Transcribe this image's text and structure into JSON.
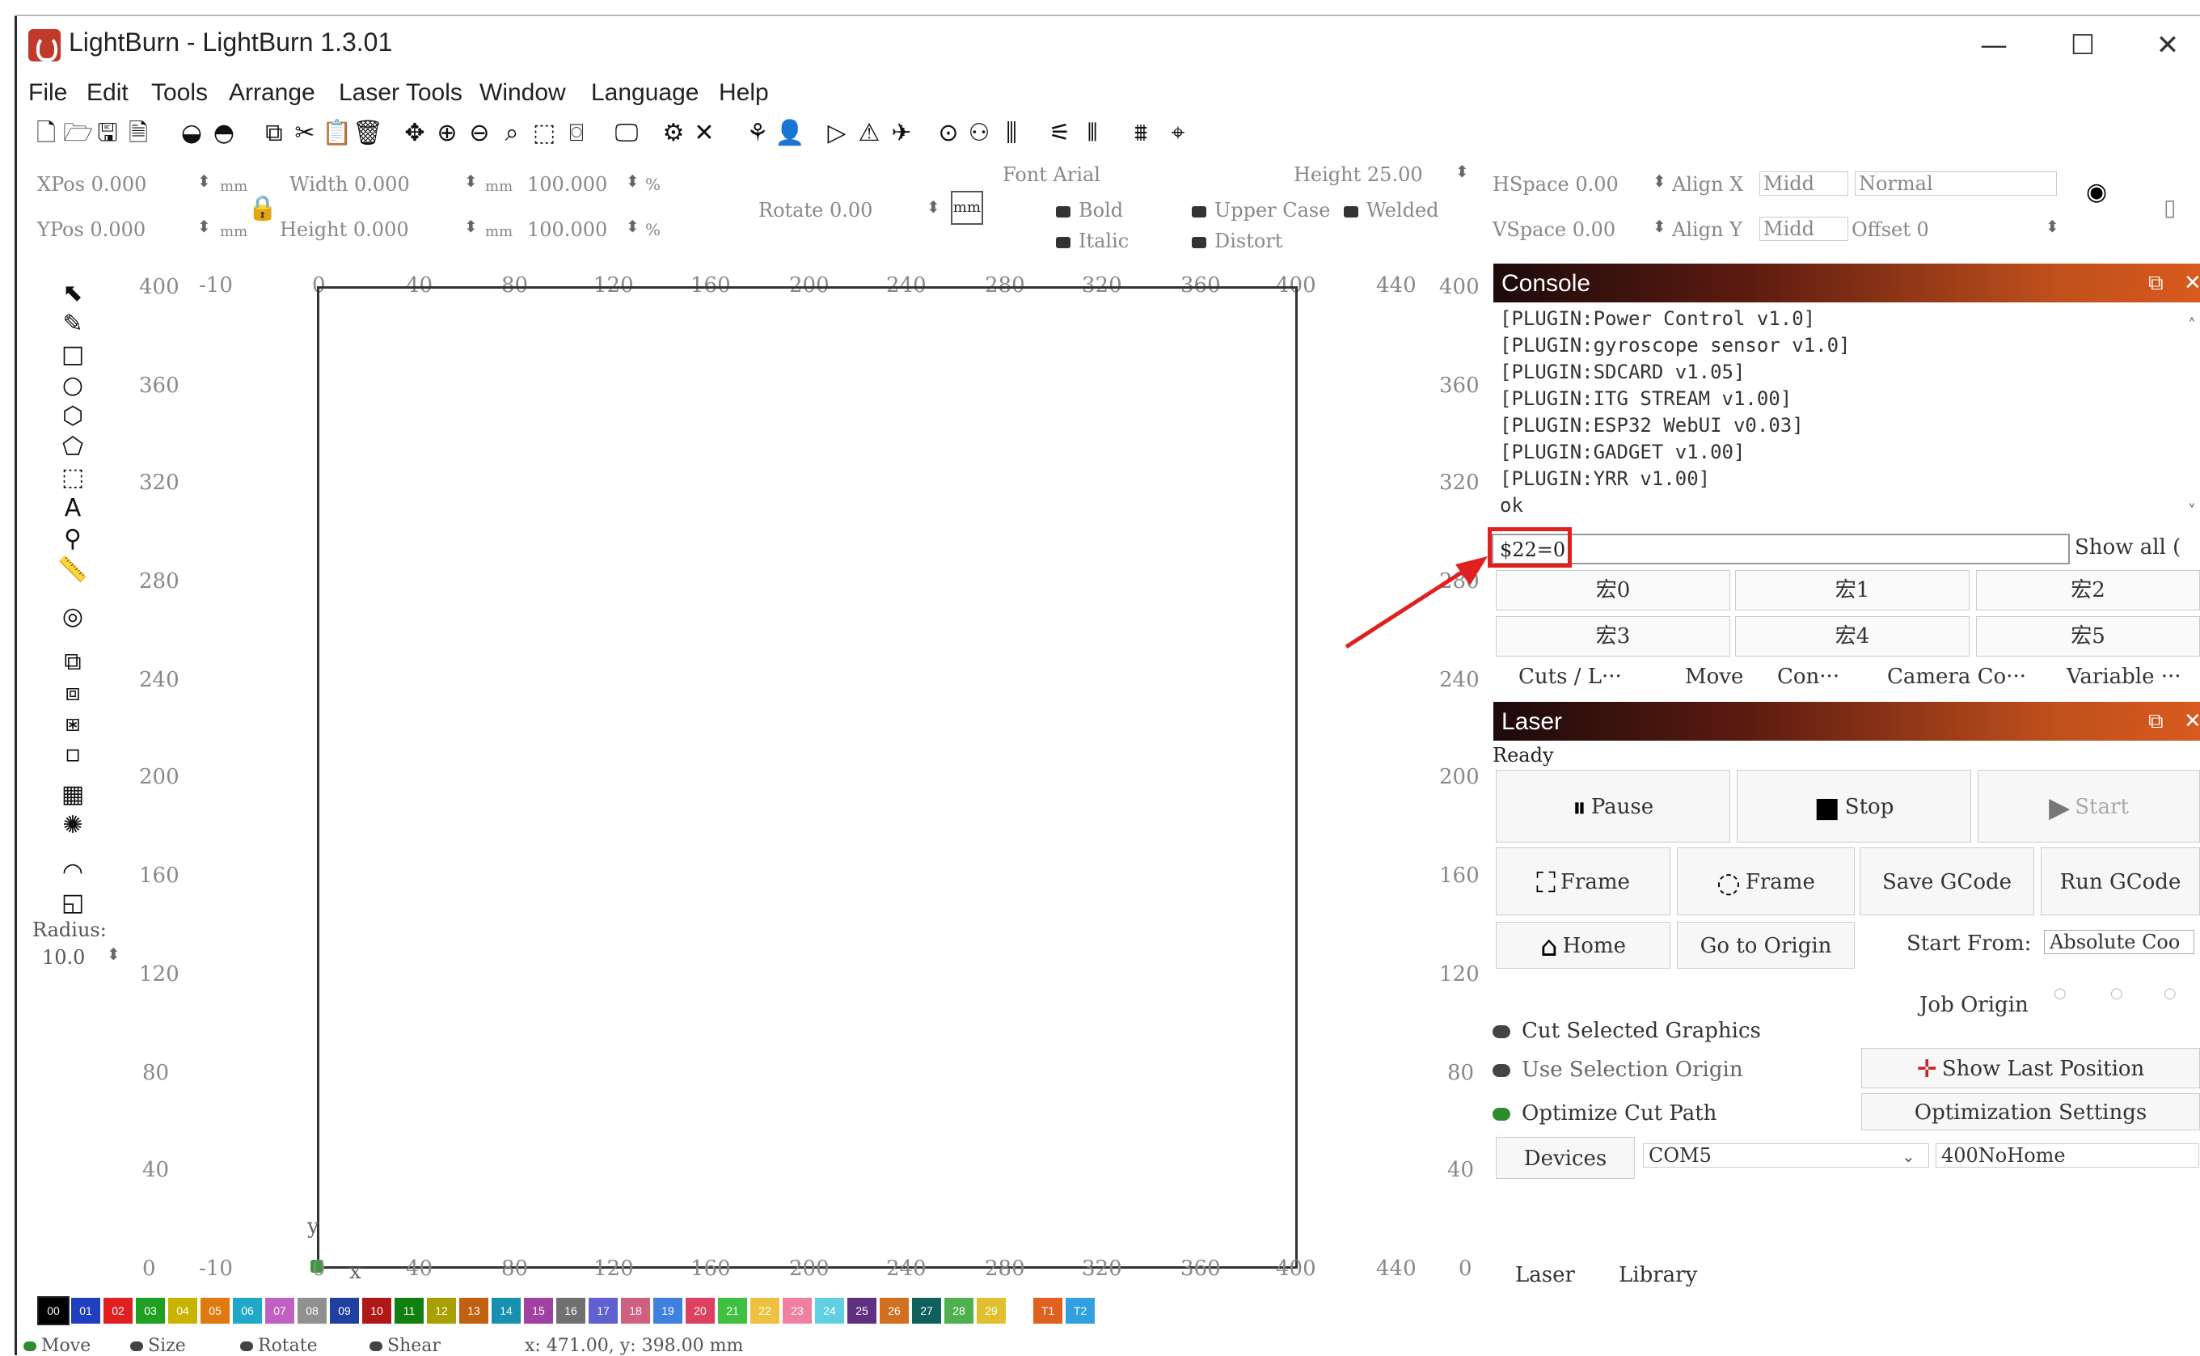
{
  "window": {
    "title": "LightBurn - LightBurn 1.3.01",
    "minimize": "—",
    "maximize": "☐",
    "close": "✕"
  },
  "menu": {
    "items": [
      "File",
      "Edit",
      "Tools",
      "Arrange",
      "Laser Tools",
      "Window",
      "Language",
      "Help"
    ]
  },
  "toolbar": {
    "icons": [
      "new-file-icon",
      "open-folder-icon",
      "save-icon",
      "save-as-icon",
      "import-icon",
      "export-icon",
      "copy-icon",
      "cut-icon",
      "paste-icon",
      "delete-icon",
      "move-icon",
      "zoom-in-icon",
      "zoom-out-icon",
      "zoom-fit-icon",
      "zoom-frame-icon",
      "camera-icon",
      "monitor-icon",
      "settings-icon",
      "tools-icon",
      "trace-icon",
      "user-icon",
      "send-icon",
      "arrange-icon",
      "dock-icon",
      "target-icon",
      "group-icon",
      "align-icon",
      "distribute-icon",
      "spacing-icon",
      "layout-icon",
      "center-icon"
    ]
  },
  "props": {
    "xpos": "XPos 0.000",
    "ypos": "YPos 0.000",
    "unit": "mm",
    "width": "Width 0.000",
    "height": "Height 0.000",
    "scale_w": "100.000",
    "scale_h": "100.000",
    "pct": "%",
    "rotate": "Rotate 0.00",
    "mm_toggle": "mm",
    "font": "Font Arial",
    "bold": "Bold",
    "italic": "Italic",
    "upper_case": "Upper Case",
    "distort": "Distort",
    "welded": "Welded",
    "font_height": "Height 25.00",
    "hspace": "HSpace 0.00",
    "vspace": "VSpace 0.00",
    "align_x": "Align X",
    "align_y": "Align Y",
    "align_x_val": "Midd",
    "align_y_val": "Midd",
    "normal": "Normal",
    "offset": "Offset 0"
  },
  "tools": {
    "radius_label": "Radius:",
    "radius_value": "10.0"
  },
  "rulers": {
    "top": [
      "-10",
      "0",
      "40",
      "80",
      "120",
      "160",
      "200",
      "240",
      "280",
      "320",
      "360",
      "400",
      "440"
    ],
    "bottom": [
      "-10",
      "0",
      "40",
      "80",
      "120",
      "160",
      "200",
      "240",
      "280",
      "320",
      "360",
      "400",
      "440"
    ],
    "left": [
      "400",
      "360",
      "320",
      "280",
      "240",
      "200",
      "160",
      "120",
      "80",
      "40",
      "0"
    ],
    "right": [
      "400",
      "360",
      "320",
      "280",
      "240",
      "200",
      "160",
      "120",
      "80",
      "40",
      "0"
    ],
    "axis_x": "x",
    "axis_y": "y"
  },
  "console": {
    "title": "Console",
    "lines": [
      "[PLUGIN:Power Control v1.0]",
      "[PLUGIN:gyroscope sensor v1.0]",
      "[PLUGIN:SDCARD v1.05]",
      "[PLUGIN:ITG STREAM v1.00]",
      "[PLUGIN:ESP32 WebUI v0.03]",
      "[PLUGIN:GADGET v1.00]",
      "[PLUGIN:YRR v1.00]",
      "ok"
    ],
    "input_value": "$22=0",
    "show_all": "Show all (",
    "macros": [
      "宏0",
      "宏1",
      "宏2",
      "宏3",
      "宏4",
      "宏5"
    ],
    "tabs": [
      "Cuts / L···",
      "Move",
      "Con···",
      "Camera Co···",
      "Variable ···"
    ]
  },
  "laser": {
    "title": "Laser",
    "status": "Ready",
    "pause": "Pause",
    "stop": "Stop",
    "start": "Start",
    "frame1": "Frame",
    "frame2": "Frame",
    "save_gcode": "Save GCode",
    "run_gcode": "Run GCode",
    "home": "Home",
    "go_to_origin": "Go to Origin",
    "start_from_label": "Start From:",
    "start_from_value": "Absolute Coo",
    "job_origin": "Job Origin",
    "cut_selected": "Cut Selected Graphics",
    "use_selection_origin": "Use Selection Origin",
    "optimize_cut_path": "Optimize Cut Path",
    "show_last_position": "Show Last Position",
    "optimization_settings": "Optimization Settings",
    "devices": "Devices",
    "port": "COM5",
    "profile": "400NoHome",
    "bottom_tabs": [
      "Laser",
      "Library"
    ]
  },
  "palette": [
    {
      "label": "00",
      "color": "#000000"
    },
    {
      "label": "01",
      "color": "#1f3fbf"
    },
    {
      "label": "02",
      "color": "#e02020"
    },
    {
      "label": "03",
      "color": "#20a020"
    },
    {
      "label": "04",
      "color": "#c8b400"
    },
    {
      "label": "05",
      "color": "#e07a10"
    },
    {
      "label": "06",
      "color": "#20a8c8"
    },
    {
      "label": "07",
      "color": "#c060c0"
    },
    {
      "label": "08",
      "color": "#909090"
    },
    {
      "label": "09",
      "color": "#2040a0"
    },
    {
      "label": "10",
      "color": "#b01818"
    },
    {
      "label": "11",
      "color": "#108010"
    },
    {
      "label": "12",
      "color": "#a8a000"
    },
    {
      "label": "13",
      "color": "#c06010"
    },
    {
      "label": "14",
      "color": "#1890b0"
    },
    {
      "label": "15",
      "color": "#a040a0"
    },
    {
      "label": "16",
      "color": "#707070"
    },
    {
      "label": "17",
      "color": "#6060d0"
    },
    {
      "label": "18",
      "color": "#d06080"
    },
    {
      "label": "19",
      "color": "#4080e0"
    },
    {
      "label": "20",
      "color": "#e04060"
    },
    {
      "label": "21",
      "color": "#40c040"
    },
    {
      "label": "22",
      "color": "#f0c040"
    },
    {
      "label": "23",
      "color": "#f080a0"
    },
    {
      "label": "24",
      "color": "#60d0e0"
    },
    {
      "label": "25",
      "color": "#603080"
    },
    {
      "label": "26",
      "color": "#d07020"
    },
    {
      "label": "27",
      "color": "#106060"
    },
    {
      "label": "28",
      "color": "#50b050"
    },
    {
      "label": "29",
      "color": "#e0c030"
    },
    {
      "label": "T1",
      "color": "#e06020"
    },
    {
      "label": "T2",
      "color": "#30a0e0"
    }
  ],
  "statusbar": {
    "move": "Move",
    "size": "Size",
    "rotate": "Rotate",
    "shear": "Shear",
    "coords": "x: 471.00, y: 398.00 mm"
  }
}
